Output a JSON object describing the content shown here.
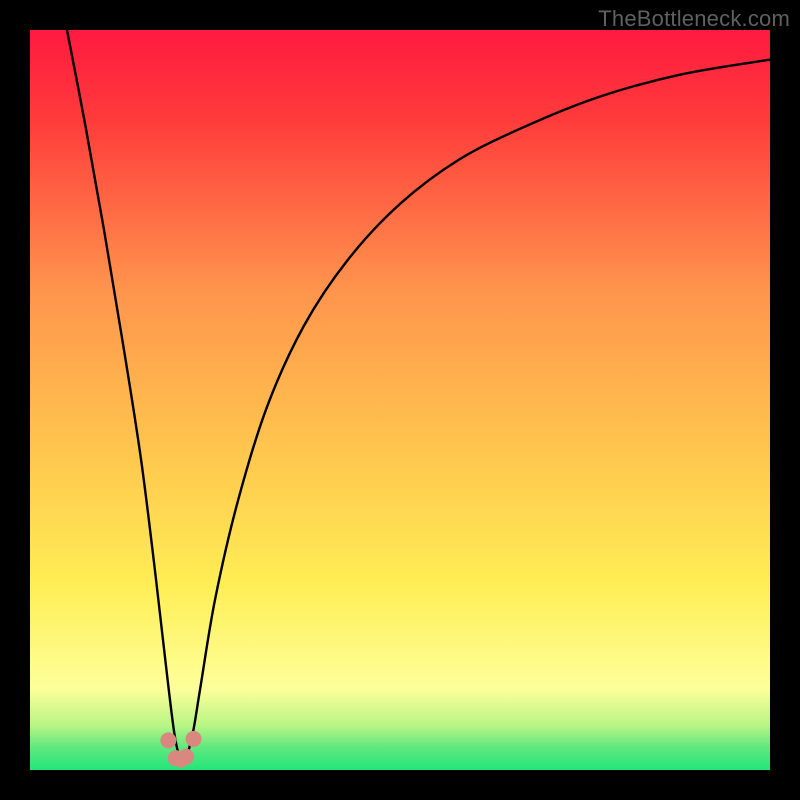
{
  "watermark": "TheBottleneck.com",
  "colors": {
    "black": "#000000",
    "curve": "#000000",
    "marker_fill": "#d98880",
    "marker_stroke": "#c0392b",
    "grad_top": "#ff1a40",
    "grad_mid_red": "#ff3b3b",
    "grad_orange": "#ff944d",
    "grad_yellow_orange": "#ffc24d",
    "grad_yellow": "#ffee55",
    "grad_pale_yellow": "#feff9a",
    "grad_lightgreen": "#9bf37c",
    "grad_green": "#22e57a"
  },
  "chart_data": {
    "type": "line",
    "title": "",
    "xlabel": "",
    "ylabel": "",
    "xlim": [
      0,
      100
    ],
    "ylim": [
      0,
      100
    ],
    "series": [
      {
        "name": "bottleneck-curve",
        "x": [
          5,
          7.5,
          10,
          12.5,
          15,
          17,
          18.5,
          19.5,
          20.3,
          21,
          22,
          23,
          25,
          28,
          32,
          37,
          43,
          50,
          58,
          67,
          77,
          88,
          100
        ],
        "values": [
          100,
          87,
          73,
          58,
          42,
          26,
          13,
          5,
          1.5,
          1.5,
          5,
          11,
          23,
          36,
          49,
          60,
          69,
          76.5,
          82.5,
          87,
          91,
          94,
          96
        ]
      }
    ],
    "markers": {
      "name": "threshold-points",
      "x": [
        18.7,
        19.7,
        20.4,
        21.1,
        22.1
      ],
      "values": [
        4.0,
        1.6,
        1.4,
        1.8,
        4.2
      ]
    }
  }
}
